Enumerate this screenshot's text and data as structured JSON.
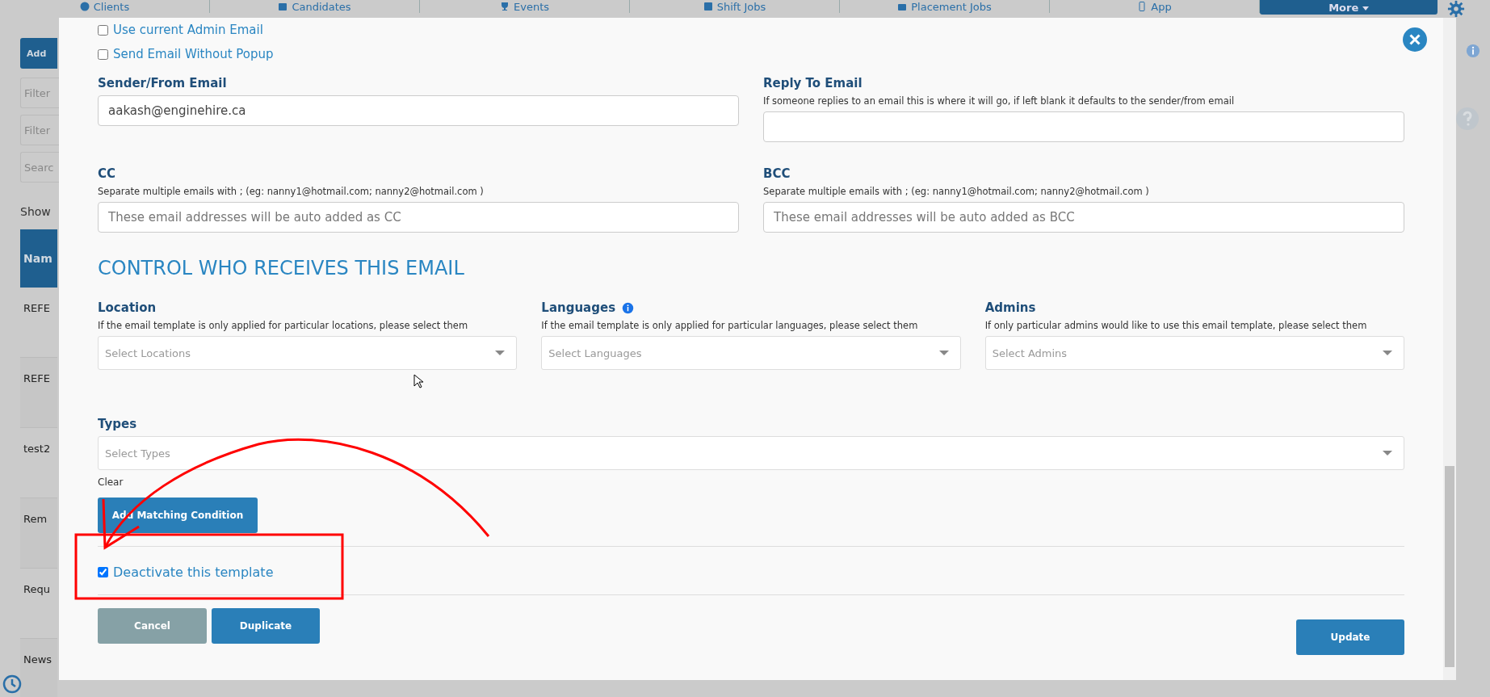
{
  "background": {
    "nav": [
      {
        "label": "Clients"
      },
      {
        "label": "Candidates"
      },
      {
        "label": "Events"
      },
      {
        "label": "Shift Jobs"
      },
      {
        "label": "Placement Jobs"
      },
      {
        "label": "App"
      }
    ],
    "more_button": "More",
    "add_button": "Add",
    "filters": [
      {
        "placeholder": "Filter"
      },
      {
        "placeholder": "Filter"
      },
      {
        "placeholder": "Searc"
      }
    ],
    "show_label": "Show",
    "table": {
      "column_1": "Nam",
      "rows": [
        "REFE",
        "REFE",
        "test2",
        "Rem",
        "Requ",
        "News"
      ]
    }
  },
  "modal": {
    "checkboxes": [
      {
        "label": "Use current Admin Email",
        "checked": false
      },
      {
        "label": "Send Email Without Popup",
        "checked": false
      }
    ],
    "sender": {
      "label": "Sender/From Email",
      "value": "aakash@enginehire.ca"
    },
    "reply_to": {
      "label": "Reply To Email",
      "help": "If someone replies to an email this is where it will go, if left blank it defaults to the sender/from email"
    },
    "cc": {
      "label": "CC",
      "help": "Separate multiple emails with ; (eg: nanny1@hotmail.com; nanny2@hotmail.com )",
      "placeholder": "These email addresses will be auto added as CC"
    },
    "bcc": {
      "label": "BCC",
      "help": "Separate multiple emails with ; (eg: nanny1@hotmail.com; nanny2@hotmail.com )",
      "placeholder": "These email addresses will be auto added as BCC"
    },
    "section_title": "CONTROL WHO RECEIVES THIS EMAIL",
    "selects": [
      {
        "label": "Location",
        "info": false,
        "help": "If the email template is only applied for particular locations, please select them",
        "placeholder": "Select Locations"
      },
      {
        "label": "Languages",
        "info": true,
        "help": "If the email template is only applied for particular languages, please select them",
        "placeholder": "Select Languages"
      },
      {
        "label": "Admins",
        "info": false,
        "help": "If only particular admins would like to use this email template, please select them",
        "placeholder": "Select Admins"
      }
    ],
    "types": {
      "label": "Types",
      "placeholder": "Select Types"
    },
    "clear_link": "Clear",
    "add_condition_button": "Add Matching Condition",
    "deactivate": {
      "label": "Deactivate this template",
      "checked": true
    },
    "buttons": {
      "cancel": "Cancel",
      "duplicate": "Duplicate",
      "update": "Update"
    }
  }
}
